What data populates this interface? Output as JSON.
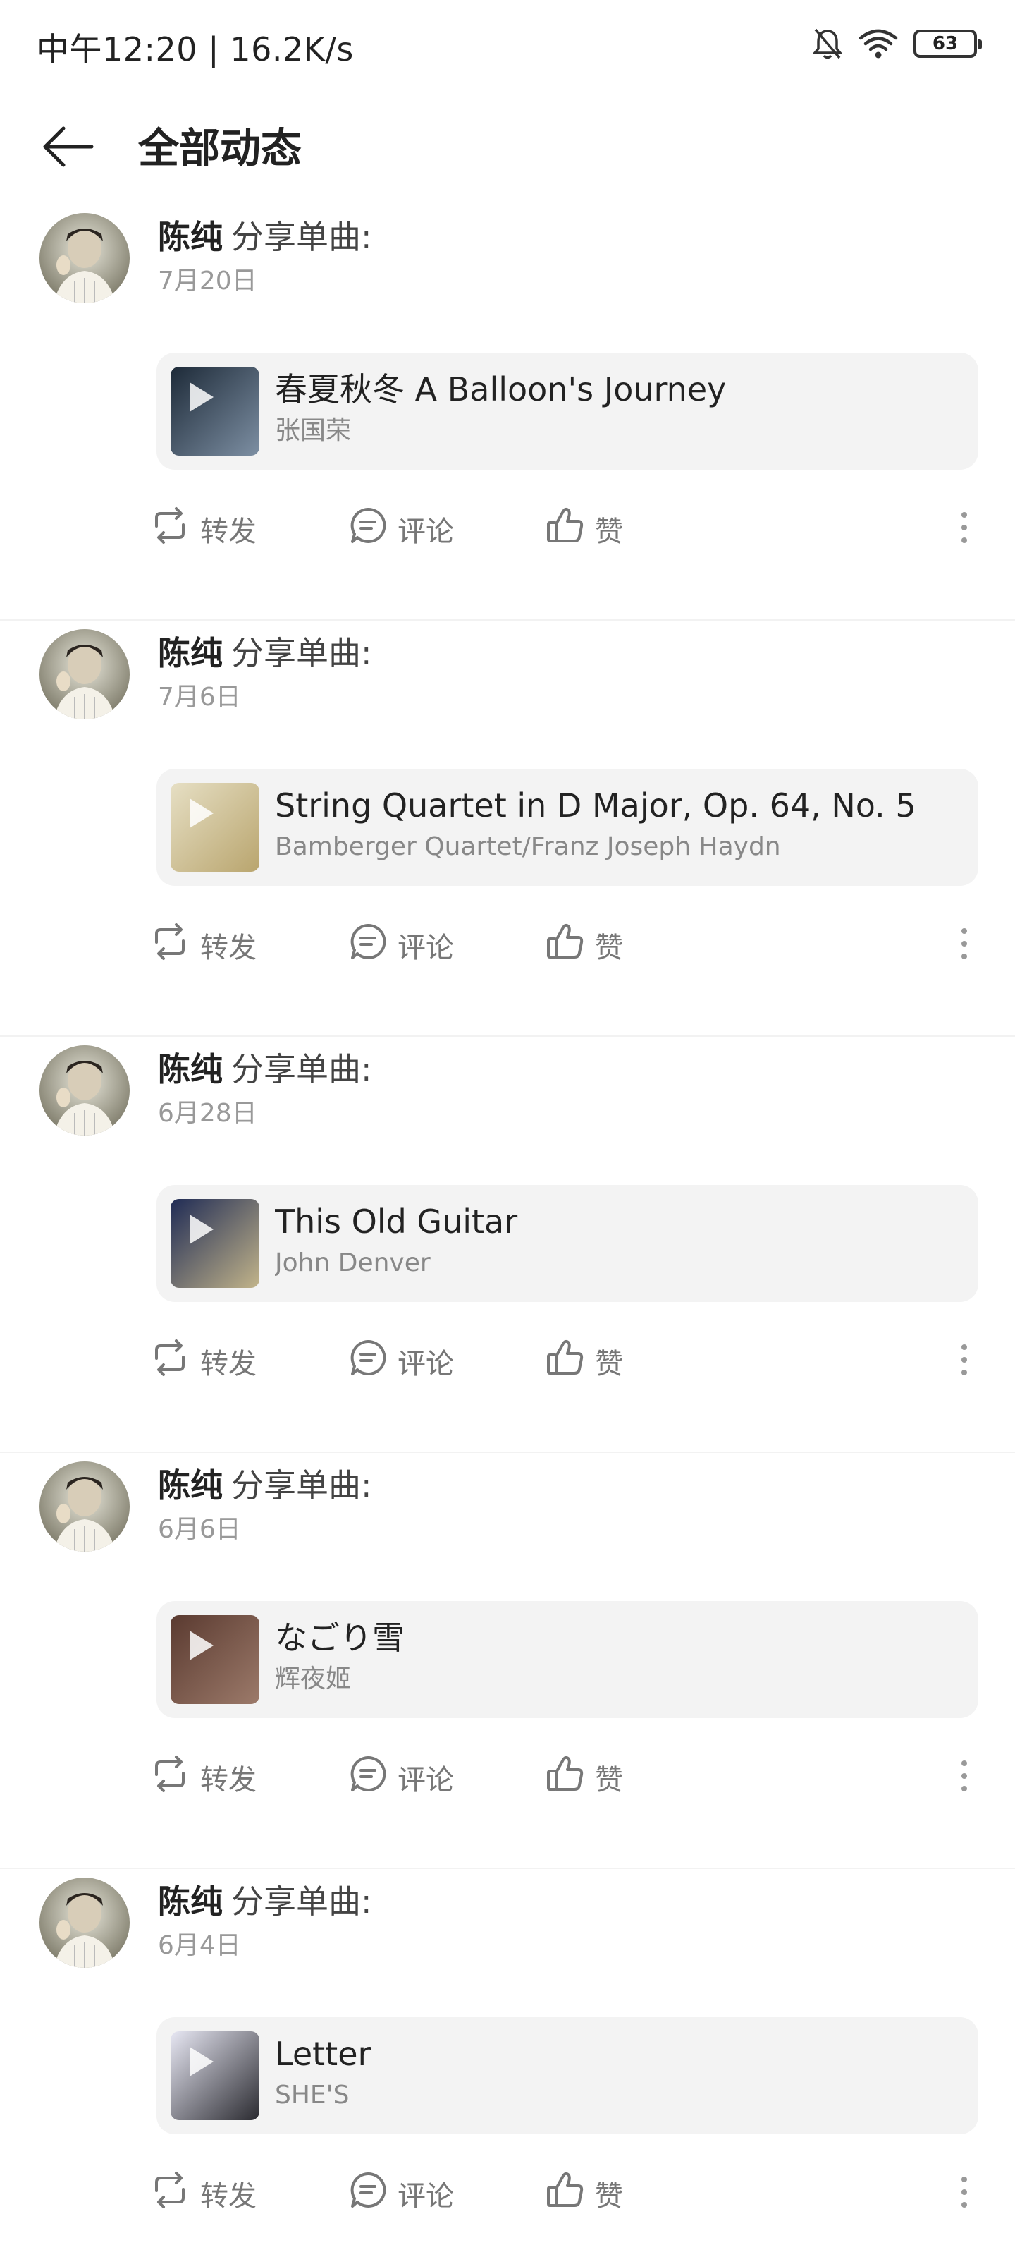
{
  "status_bar": {
    "left_text": "中午12:20 | 16.2K/s",
    "battery": "63"
  },
  "header": {
    "title": "全部动态"
  },
  "labels": {
    "share": "转发",
    "comment": "评论",
    "like": "赞"
  },
  "posts": [
    {
      "author": "陈纯",
      "action": "分享单曲:",
      "date": "7月20日",
      "song_title": "春夏秋冬 A Balloon's Journey",
      "song_artist": "张国荣",
      "cover_colors": [
        "#1d2a38",
        "#7d8fa3"
      ]
    },
    {
      "author": "陈纯",
      "action": "分享单曲:",
      "date": "7月6日",
      "song_title": "String Quartet in D Major, Op. 64, No. 5",
      "song_artist": "Bamberger Quartet/Franz Joseph Haydn",
      "cover_colors": [
        "#e6dfc4",
        "#b9a56e"
      ]
    },
    {
      "author": "陈纯",
      "action": "分享单曲:",
      "date": "6月28日",
      "song_title": "This Old Guitar",
      "song_artist": "John Denver",
      "cover_colors": [
        "#1f2b55",
        "#c2b48a"
      ]
    },
    {
      "author": "陈纯",
      "action": "分享单曲:",
      "date": "6月6日",
      "song_title": "なごり雪",
      "song_artist": "辉夜姬",
      "cover_colors": [
        "#5a3a30",
        "#9c7a6a"
      ]
    },
    {
      "author": "陈纯",
      "action": "分享单曲:",
      "date": "6月4日",
      "song_title": "Letter",
      "song_artist": "SHE'S",
      "cover_colors": [
        "#e8e8f4",
        "#2a2a30"
      ]
    }
  ],
  "icons": {
    "back": "arrow-left-icon",
    "share": "repost-icon",
    "comment": "comment-icon",
    "like": "thumbs-up-icon",
    "more": "more-vertical-icon"
  }
}
